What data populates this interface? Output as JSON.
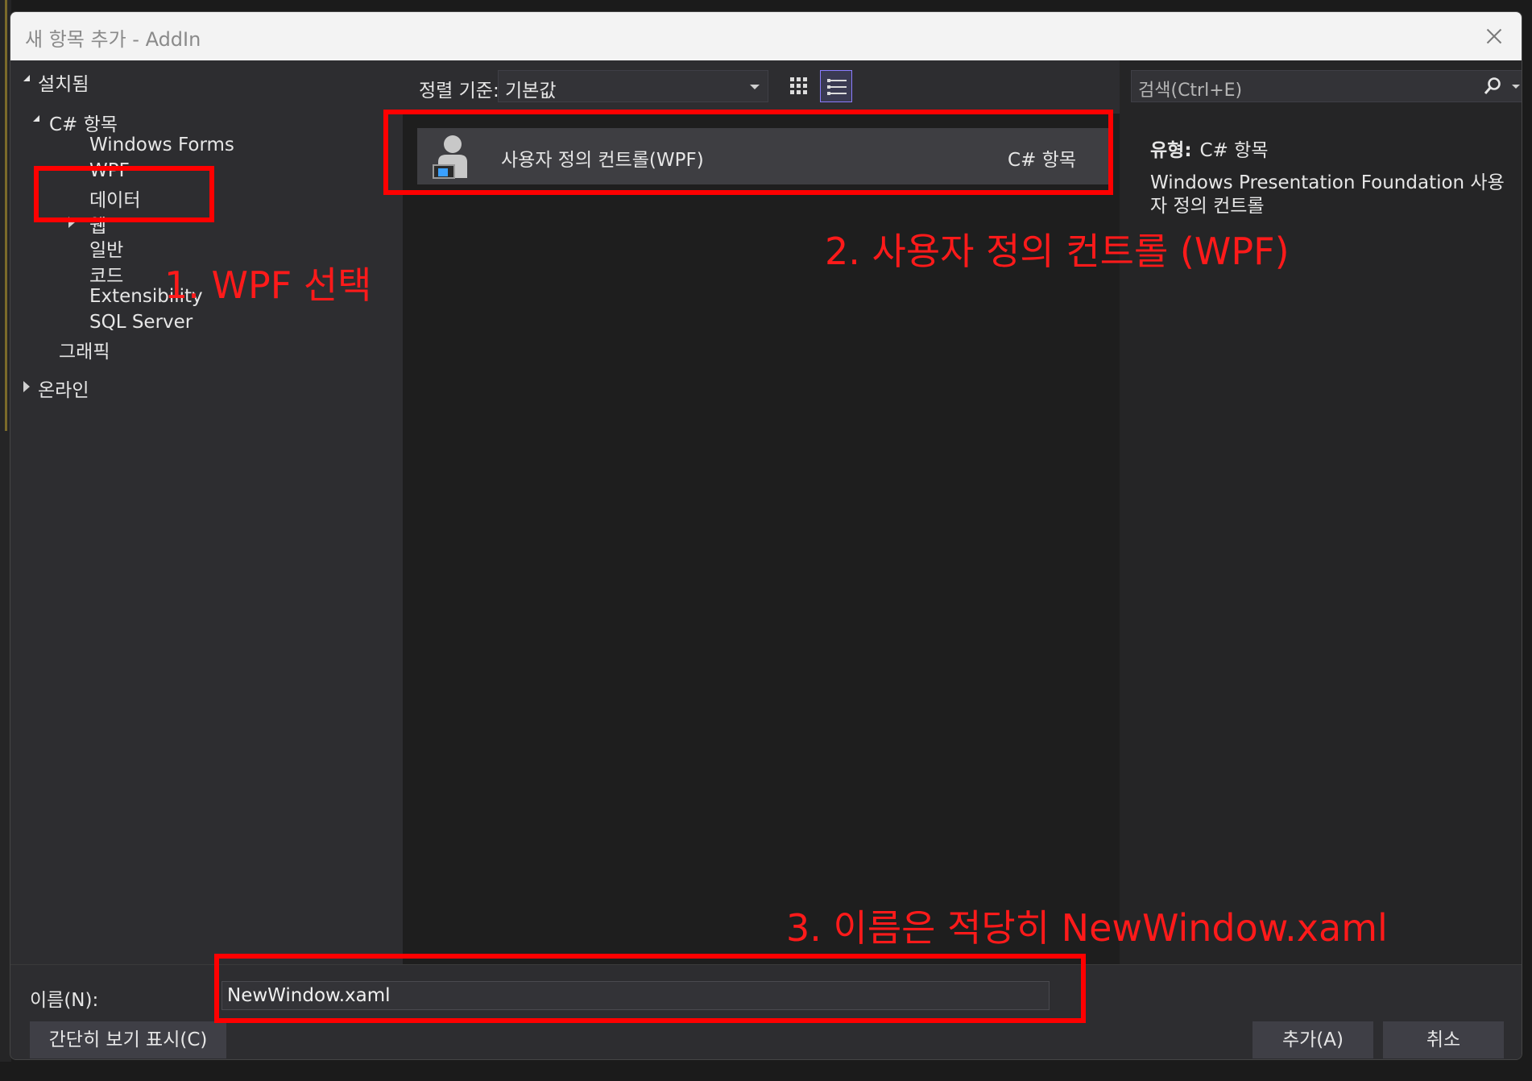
{
  "window": {
    "title": "새 항목 추가 - AddIn",
    "close_label": "close"
  },
  "tree": {
    "installed": "설치됨",
    "csharp": "C# 항목",
    "children": [
      "Windows Forms",
      "WPF",
      "데이터",
      "웹",
      "일반",
      "코드",
      "Extensibility",
      "SQL Server"
    ],
    "graphics": "그래픽",
    "online": "온라인"
  },
  "toolbar": {
    "sort_label": "정렬 기준:",
    "sort_value": "기본값"
  },
  "templates": [
    {
      "name": "사용자 정의 컨트롤(WPF)",
      "type": "C# 항목"
    }
  ],
  "search": {
    "placeholder": "검색(Ctrl+E)"
  },
  "info": {
    "type_label": "유형:",
    "type_value": "C# 항목",
    "description": "Windows Presentation Foundation 사용자 정의 컨트롤"
  },
  "bottom": {
    "name_label": "이름(N):",
    "name_value": "NewWindow.xaml",
    "compact_button": "간단히 보기 표시(C)",
    "add_button": "추가(A)",
    "cancel_button": "취소"
  },
  "annotations": {
    "step1": "1. WPF 선택",
    "step2": "2. 사용자 정의 컨트롤 (WPF)",
    "step3": "3. 이름은 적당히 NewWindow.xaml"
  },
  "colors": {
    "annotation": "#ff0000",
    "accent": "#8a7cff",
    "background": "#2d2d30"
  },
  "icons": [
    "close-icon",
    "expand-triangle-icon",
    "collapse-triangle-icon",
    "grid-view-icon",
    "list-view-icon",
    "user-control-icon",
    "search-icon"
  ]
}
